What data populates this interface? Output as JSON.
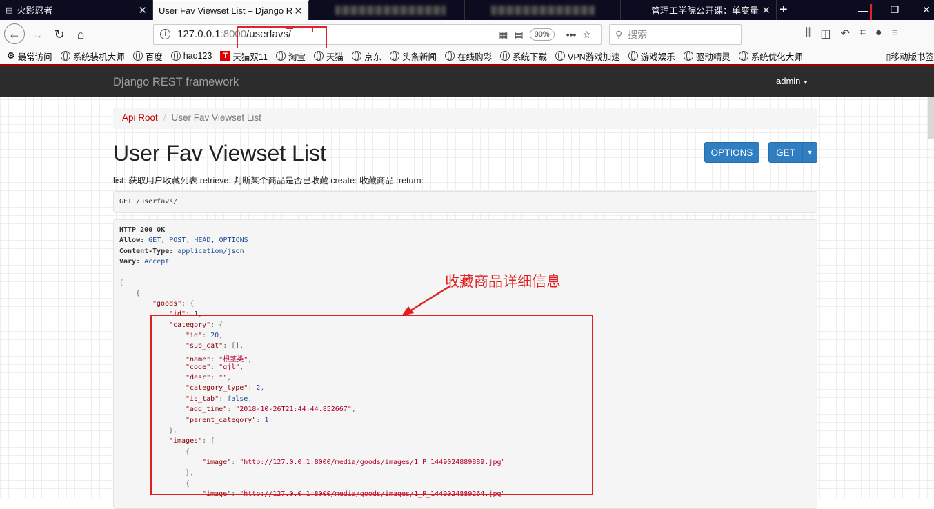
{
  "browser": {
    "tabs": [
      {
        "title": "火影忍者",
        "active": false
      },
      {
        "title": "User Fav Viewset List – Django R",
        "active": true
      },
      {
        "title": "",
        "active": false,
        "blurred": true
      },
      {
        "title": "",
        "active": false,
        "blurred": true
      },
      {
        "title": "管理工学院公开课：单变量",
        "active": false
      }
    ],
    "url_host": "127.0.0.1",
    "url_port": ":8000",
    "url_path": "/userfavs/",
    "zoom": "90%",
    "search_placeholder": "搜索",
    "bookmarks": [
      "最常访问",
      "系统装机大师",
      "百度",
      "hao123",
      "天猫双11",
      "淘宝",
      "天猫",
      "京东",
      "头条新闻",
      "在线购彩",
      "系统下载",
      "VPN游戏加速",
      "游戏娱乐",
      "驱动精灵",
      "系统优化大师"
    ],
    "mobile_bookmarks": "移动版书签"
  },
  "drf": {
    "brand": "Django REST framework",
    "user": "admin",
    "breadcrumb_root": "Api Root",
    "breadcrumb_current": "User Fav Viewset List",
    "title": "User Fav Viewset List",
    "options_label": "OPTIONS",
    "get_label": "GET",
    "description": "list: 获取用户收藏列表 retrieve: 判断某个商品是否已收藏 create: 收藏商品 :return:",
    "request_line": "GET /userfavs/",
    "response": {
      "status": "HTTP 200 OK",
      "allow_label": "Allow:",
      "allow_value": "GET, POST, HEAD, OPTIONS",
      "content_type_label": "Content-Type:",
      "content_type_value": "application/json",
      "vary_label": "Vary:",
      "vary_value": "Accept"
    },
    "json": {
      "goods_id": "1",
      "category_id": "20",
      "name": "\"根茎类\"",
      "code": "\"gjl\"",
      "desc": "\"\"",
      "category_type": "2",
      "is_tab": "false",
      "add_time": "\"2018-10-26T21:44:44.852667\"",
      "parent_category": "1",
      "image_1": "\"http://127.0.0.1:8000/media/goods/images/1_P_1449024889889.jpg\"",
      "image_2": "\"http://127.0.0.1:8000/media/goods/images/1_P_1449024889264.jpg\""
    }
  },
  "annotation": {
    "text": "收藏商品详细信息",
    "color": "#e02020"
  }
}
